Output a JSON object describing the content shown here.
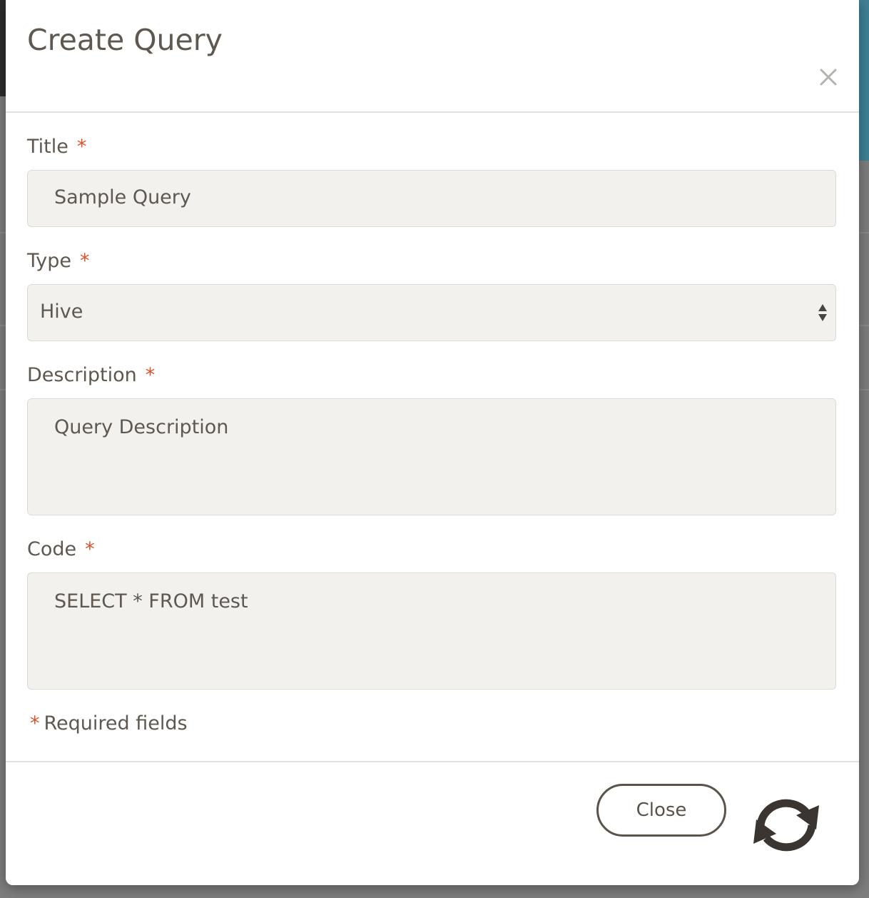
{
  "modal": {
    "title": "Create Query",
    "close_icon": "close-icon"
  },
  "form": {
    "required_marker": "*",
    "title": {
      "label": "Title",
      "value": "Sample Query"
    },
    "type": {
      "label": "Type",
      "selected": "Hive"
    },
    "description": {
      "label": "Description",
      "value": "Query Description"
    },
    "code": {
      "label": "Code",
      "value": "SELECT * FROM test"
    },
    "required_note": "Required fields"
  },
  "footer": {
    "close_label": "Close",
    "refresh_icon": "refresh-icon"
  },
  "colors": {
    "accent_required": "#d9532c",
    "text": "#5e5850",
    "input_bg": "#f2f1ee"
  }
}
